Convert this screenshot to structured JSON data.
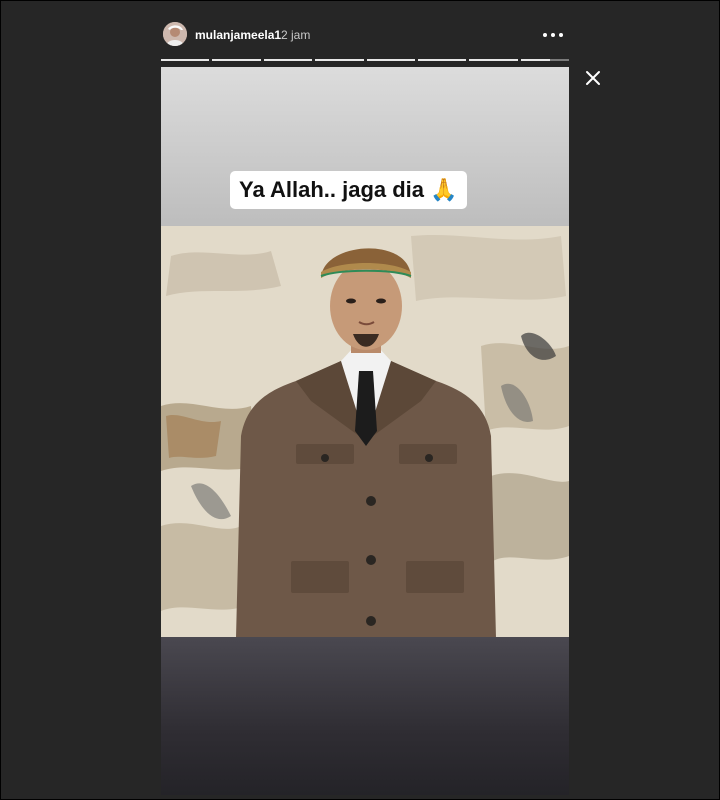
{
  "header": {
    "username": "mulanjameela1",
    "timestamp": "2 jam",
    "more_icon": "more-horizontal-icon"
  },
  "progress": {
    "segments": 8,
    "completed": 7
  },
  "close_icon": "close-icon",
  "story": {
    "caption_text": "Ya Allah.. jaga dia",
    "caption_emoji": "🙏"
  },
  "colors": {
    "background": "#262626",
    "caption_bg": "#ffffff",
    "text_primary": "#ffffff",
    "text_secondary": "#c8c8c8"
  }
}
